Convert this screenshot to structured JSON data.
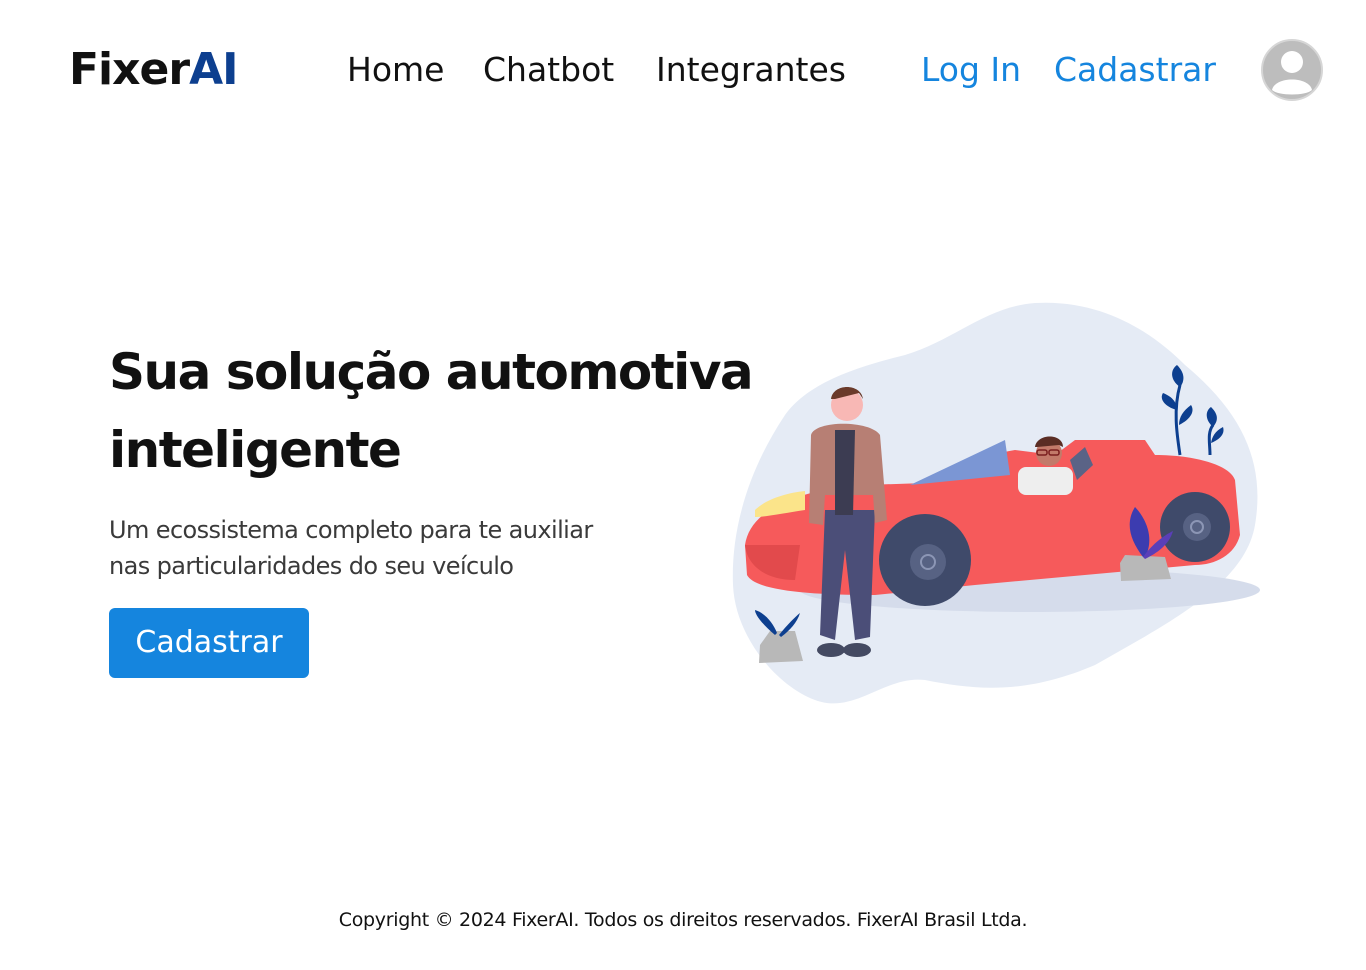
{
  "brand": {
    "name_part1": "Fixer",
    "name_part2": "AI",
    "accent_color": "#0d3f8f"
  },
  "nav": {
    "links": [
      {
        "label": "Home"
      },
      {
        "label": "Chatbot"
      },
      {
        "label": "Integrantes"
      }
    ],
    "login_label": "Log In",
    "signup_label": "Cadastrar",
    "link_color": "#1585de",
    "avatar_icon": "user-avatar-icon"
  },
  "hero": {
    "title_line1": "Sua solução automotiva",
    "title_line2": "inteligente",
    "subtitle_line1": "Um ecossistema completo para te auxiliar",
    "subtitle_line2": "nas particularidades do seu veículo",
    "cta_label": "Cadastrar",
    "cta_color": "#1585de",
    "illustration": "two-people-with-red-convertible-car-illustration",
    "car_color": "#f65a5b",
    "blob_color": "#e5ebf5"
  },
  "footer": {
    "copyright": "Copyright © 2024 FixerAI. Todos os direitos reservados. FixerAI Brasil Ltda."
  }
}
